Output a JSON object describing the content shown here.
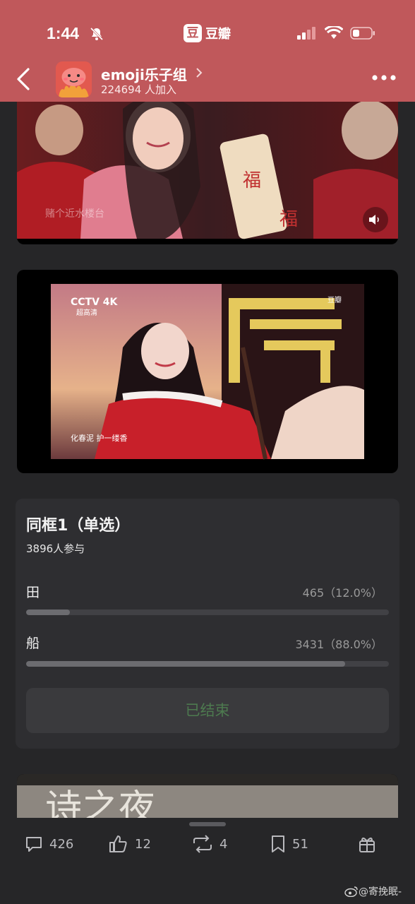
{
  "status_bar": {
    "time": "1:44",
    "app_name": "豆瓣",
    "app_logo_char": "豆"
  },
  "nav": {
    "group_name": "emoji乐子组",
    "members": "224694 人加入"
  },
  "poll": {
    "title": "同框1（单选）",
    "participants": "3896人参与",
    "options": [
      {
        "label": "田",
        "stat": "465（12.0%）",
        "fraction": 0.12
      },
      {
        "label": "船",
        "stat": "3431（88.0%）",
        "fraction": 0.88
      }
    ],
    "status_button": "已结束"
  },
  "video1": {
    "caption": "赌个近水楼台"
  },
  "video2": {
    "channel": "CCTV 4K",
    "channel_sub": "超高清",
    "lyric": "化春泥 护一缕香",
    "tag": "豆瓣"
  },
  "video3": {
    "banner_text": "诗之夜"
  },
  "actions": {
    "comments": "426",
    "likes": "12",
    "reposts": "4",
    "collects": "51"
  },
  "watermark": "@寄挽眠-",
  "colors": {
    "header": "#c0585b",
    "background": "#262628",
    "poll_card": "#2e2e31",
    "ended_text": "#4d7a4f"
  }
}
